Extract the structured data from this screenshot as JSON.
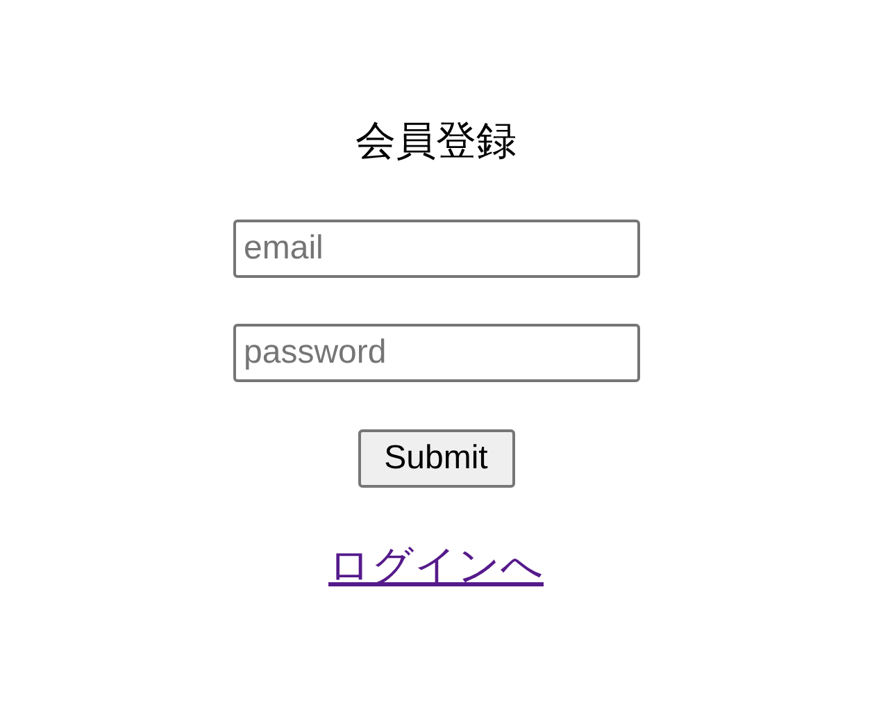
{
  "title": "会員登録",
  "fields": [
    {
      "placeholder": "email"
    },
    {
      "placeholder": "password"
    }
  ],
  "submit": "Submit",
  "link": "ログインへ"
}
